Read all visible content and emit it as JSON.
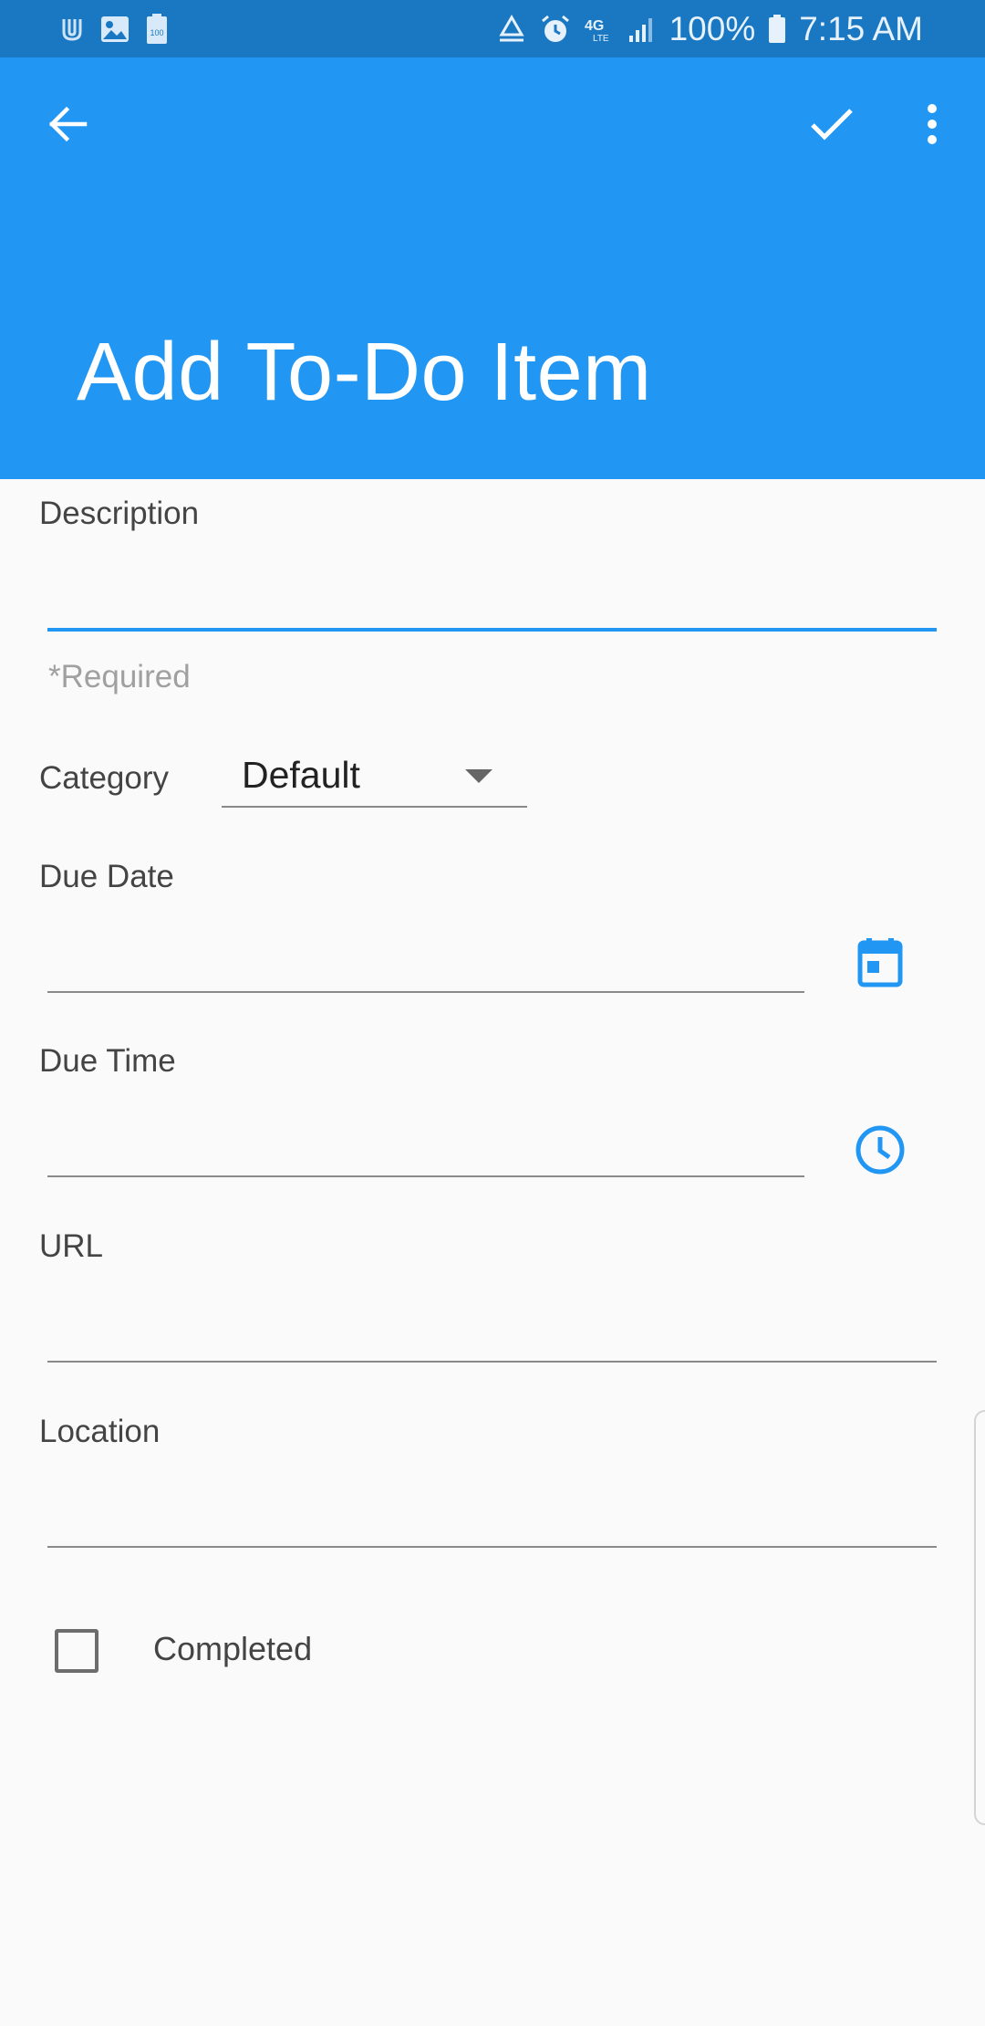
{
  "status_bar": {
    "left_icons": [
      "u-notification-icon",
      "image-icon",
      "battery-100-icon"
    ],
    "right_icons": [
      "sync-icon",
      "alarm-icon",
      "4g-lte-icon",
      "signal-icon"
    ],
    "battery_text": "100%",
    "time": "7:15 AM"
  },
  "app_bar": {
    "title": "Add To-Do Item",
    "back_icon": "arrow-back-icon",
    "save_icon": "check-icon",
    "menu_icon": "more-vert-icon"
  },
  "form": {
    "description": {
      "label": "Description",
      "value": "",
      "helper": "*Required"
    },
    "category": {
      "label": "Category",
      "selected": "Default"
    },
    "due_date": {
      "label": "Due Date",
      "value": "",
      "icon": "calendar-icon"
    },
    "due_time": {
      "label": "Due Time",
      "value": "",
      "icon": "clock-icon"
    },
    "url": {
      "label": "URL",
      "value": ""
    },
    "location": {
      "label": "Location",
      "value": ""
    },
    "completed": {
      "label": "Completed",
      "checked": false
    }
  },
  "colors": {
    "primary": "#2196f3",
    "status_bar": "#1a78c2",
    "background": "#fafafa",
    "label_text": "#444444",
    "helper_text": "#a0a0a0"
  }
}
